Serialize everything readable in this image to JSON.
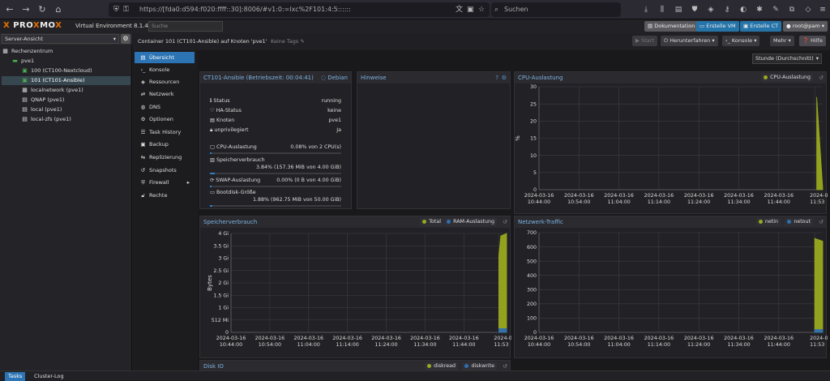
{
  "browser": {
    "url": "https://[fda0:d594:f020:ffff::30]:8006/#v1:0:=lxc%2F101:4:5::::::",
    "search_placeholder": "Suchen"
  },
  "pve": {
    "version": "Virtual Environment 8.1.4",
    "search_placeholder": "Suche",
    "buttons": {
      "docs": "Dokumentation",
      "create_vm": "Erstelle VM",
      "create_ct": "Erstelle CT",
      "user": "root@pam"
    }
  },
  "tree": {
    "view": "Server-Ansicht",
    "nodes": [
      {
        "label": "Rechenzentrum",
        "icon": "datacenter-icon"
      },
      {
        "label": "pve1",
        "icon": "node-icon"
      },
      {
        "label": "100 (CT100-Nextcloud)",
        "icon": "container-icon"
      },
      {
        "label": "101 (CT101-Ansible)",
        "icon": "container-icon"
      },
      {
        "label": "localnetwork (pve1)",
        "icon": "network-grid-icon"
      },
      {
        "label": "QNAP (pve1)",
        "icon": "storage-icon"
      },
      {
        "label": "local (pve1)",
        "icon": "storage-icon"
      },
      {
        "label": "local-zfs (pve1)",
        "icon": "storage-icon"
      }
    ]
  },
  "toolbar": {
    "title": "Container 101 (CT101-Ansible) auf Knoten 'pve1'",
    "tags": "Keine Tags",
    "start": "Start",
    "shutdown": "Herunterfahren",
    "console": "Konsole",
    "more": "Mehr",
    "help": "Hilfe"
  },
  "nav": [
    {
      "label": "Übersicht",
      "icon": "book-icon"
    },
    {
      "label": "Konsole",
      "icon": "terminal-icon"
    },
    {
      "label": "Ressourcen",
      "icon": "cube-icon"
    },
    {
      "label": "Netzwerk",
      "icon": "network-icon"
    },
    {
      "label": "DNS",
      "icon": "globe-icon"
    },
    {
      "label": "Optionen",
      "icon": "gear-icon"
    },
    {
      "label": "Task History",
      "icon": "list-icon"
    },
    {
      "label": "Backup",
      "icon": "floppy-icon"
    },
    {
      "label": "Replizierung",
      "icon": "retweet-icon"
    },
    {
      "label": "Snapshots",
      "icon": "history-icon"
    },
    {
      "label": "Firewall",
      "icon": "shield-icon"
    },
    {
      "label": "Rechte",
      "icon": "unlock-icon"
    }
  ],
  "timeframe": "Stunde (Durchschnitt)",
  "status": {
    "title": "CT101-Ansible (Betriebszeit: 00:04:41)",
    "os": "Debian",
    "rows": [
      {
        "label": "Status",
        "value": "running"
      },
      {
        "label": "HA-Status",
        "value": "keine"
      },
      {
        "label": "Knoten",
        "value": "pve1"
      },
      {
        "label": "unprivilegiert",
        "value": "Ja"
      }
    ],
    "cpu_label": "CPU-Auslastung",
    "cpu_value": "0.08% von 2 CPU(s)",
    "cpu_fraction": 0.0008,
    "mem_label": "Speicherverbrauch",
    "mem_value": "3.84% (157.36 MiB von 4.00 GiB)",
    "mem_fraction": 0.0384,
    "swap_label": "SWAP-Auslastung",
    "swap_value": "0.00% (0 B von 4.00 GiB)",
    "swap_fraction": 0,
    "disk_label": "Bootdisk-Größe",
    "disk_value": "1.88% (962.75 MiB von 50.00 GiB)",
    "disk_fraction": 0.0188
  },
  "notes": {
    "title": "Hinweise"
  },
  "bottom": {
    "tasks": "Tasks",
    "cluster_log": "Cluster-Log"
  },
  "chart_data": [
    {
      "id": "cpu",
      "type": "area",
      "title": "CPU-Auslastung",
      "ylabel": "%",
      "ylim": [
        0,
        30
      ],
      "yticks": [
        "0",
        "5",
        "10",
        "15",
        "20",
        "25",
        "30"
      ],
      "x": [
        "2024-03-16 10:44:00",
        "2024-03-16 10:54:00",
        "2024-03-16 11:04:00",
        "2024-03-16 11:14:00",
        "2024-03-16 11:24:00",
        "2024-03-16 11:34:00",
        "2024-03-16 11:44:00",
        "2024-03-16 11:53"
      ],
      "xticks_date": [
        "2024-03-16",
        "2024-03-16",
        "2024-03-16",
        "2024-03-16",
        "2024-03-16",
        "2024-03-16",
        "2024-03-16",
        "2024-0"
      ],
      "xticks_time": [
        "10:44:00",
        "10:54:00",
        "11:04:00",
        "11:14:00",
        "11:24:00",
        "11:34:00",
        "11:44:00",
        "11:53"
      ],
      "series": [
        {
          "name": "CPU-Auslastung",
          "color": "#9aaa1e",
          "values": [
            [
              69.5,
              27
            ],
            [
              71,
              0.5
            ]
          ]
        }
      ],
      "grid": true,
      "legend": "top-right"
    },
    {
      "id": "mem",
      "type": "area",
      "title": "Speicherverbrauch",
      "ylabel": "Bytes",
      "ylim": [
        0,
        4.0
      ],
      "yticks": [
        "0",
        "512 Mi",
        "1 Gi",
        "1.5 Gi",
        "2 Gi",
        "2.5 Gi",
        "3 Gi",
        "3.5 Gi",
        "4 Gi"
      ],
      "xticks_date": [
        "2024-03-16",
        "2024-03-16",
        "2024-03-16",
        "2024-03-16",
        "2024-03-16",
        "2024-03-16",
        "2024-03-16",
        "2024-0"
      ],
      "xticks_time": [
        "10:44:00",
        "10:54:00",
        "11:04:00",
        "11:14:00",
        "11:24:00",
        "11:34:00",
        "11:44:00",
        "11:53"
      ],
      "series": [
        {
          "name": "Total",
          "color": "#9aaa1e",
          "values": [
            [
              69,
              3.1
            ],
            [
              69.5,
              3.9
            ],
            [
              71,
              4.0
            ]
          ]
        },
        {
          "name": "RAM-Auslastung",
          "color": "#2f6fb0",
          "values": [
            [
              69,
              0.15
            ],
            [
              71,
              0.15
            ]
          ]
        }
      ],
      "grid": true,
      "legend": "top-right"
    },
    {
      "id": "net",
      "type": "area",
      "title": "Netzwerk-Traffic",
      "ylim": [
        0,
        700
      ],
      "yticks": [
        "0",
        "100",
        "200",
        "300",
        "400",
        "500",
        "600",
        "700"
      ],
      "xticks_date": [
        "2024-03-16",
        "2024-03-16",
        "2024-03-16",
        "2024-03-16",
        "2024-03-16",
        "2024-03-16",
        "2024-03-16",
        "2024-0"
      ],
      "xticks_time": [
        "10:44:00",
        "10:54:00",
        "11:04:00",
        "11:14:00",
        "11:24:00",
        "11:34:00",
        "11:44:00",
        "11:53"
      ],
      "series": [
        {
          "name": "netin",
          "color": "#9aaa1e",
          "values": [
            [
              69,
              660
            ],
            [
              71,
              640
            ]
          ]
        },
        {
          "name": "netout",
          "color": "#2f6fb0",
          "values": [
            [
              69,
              20
            ],
            [
              71,
              20
            ]
          ]
        }
      ],
      "grid": true,
      "legend": "top-right"
    },
    {
      "id": "disk",
      "type": "area",
      "title": "Disk IO",
      "series": [
        {
          "name": "diskread",
          "color": "#9aaa1e"
        },
        {
          "name": "diskwrite",
          "color": "#2f6fb0"
        }
      ],
      "legend": "top-right"
    }
  ]
}
